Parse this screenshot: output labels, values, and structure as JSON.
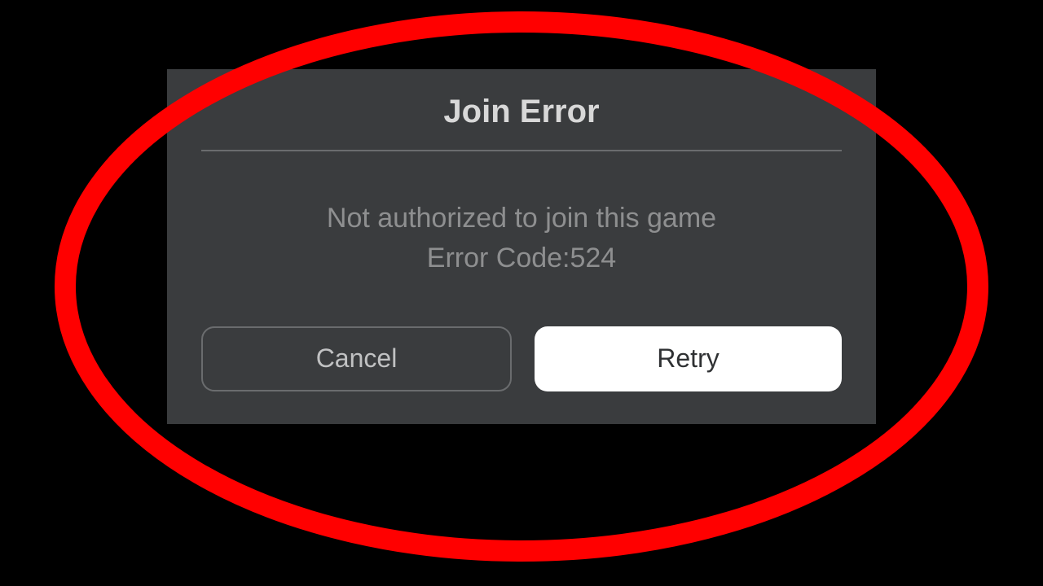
{
  "dialog": {
    "title": "Join Error",
    "message_line1": "Not authorized to join this game",
    "message_line2": "Error Code:524",
    "cancel_label": "Cancel",
    "retry_label": "Retry"
  },
  "annotation": {
    "ellipse_color": "#ff0000"
  }
}
